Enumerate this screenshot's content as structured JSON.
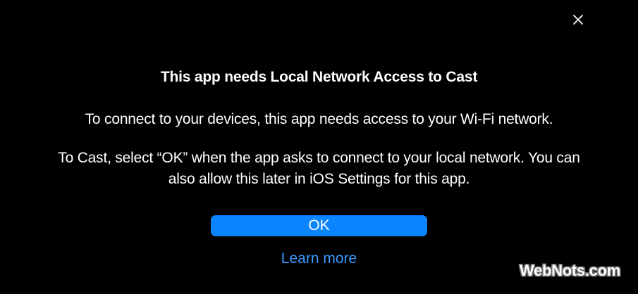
{
  "dialog": {
    "title": "This app needs Local Network Access to Cast",
    "paragraph_1": "To connect to your devices, this app needs access to your Wi-Fi network.",
    "paragraph_2": "To Cast, select “OK” when the app asks to connect to your local network. You can also allow this later in iOS Settings for this app.",
    "ok_label": "OK",
    "learn_more_label": "Learn more",
    "close_icon": "close-icon"
  },
  "watermark": {
    "text": "WebNots.com"
  },
  "colors": {
    "background": "#000000",
    "text": "#ffffff",
    "accent": "#0a84ff",
    "link": "#3a9bff"
  }
}
